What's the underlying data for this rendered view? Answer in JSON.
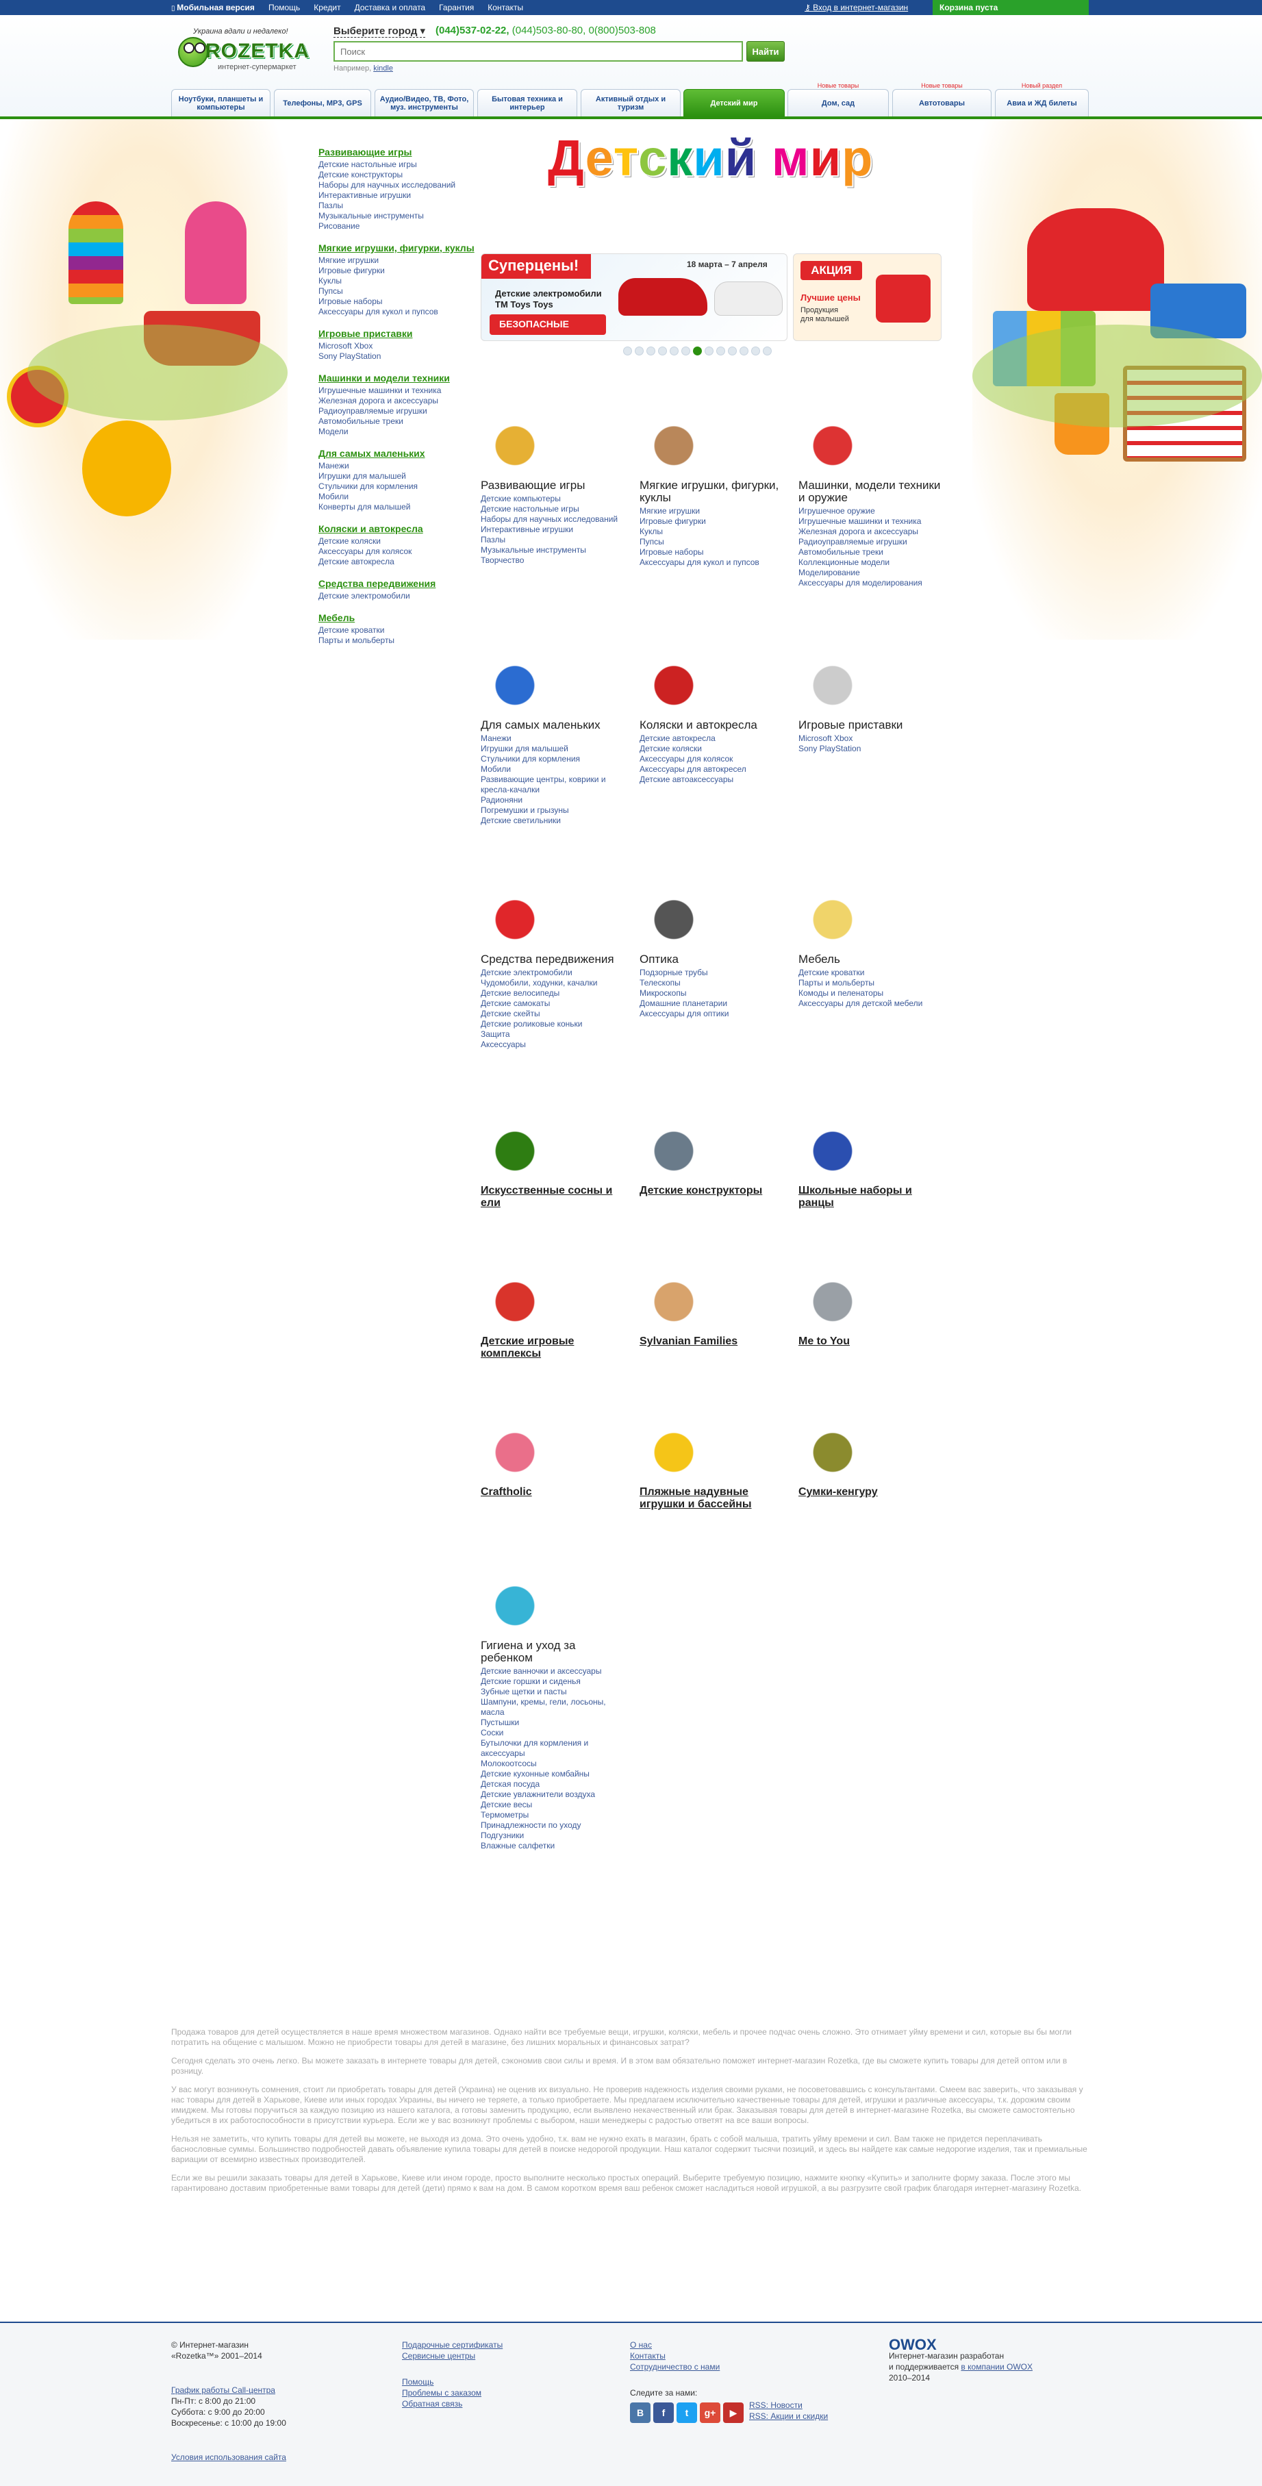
{
  "topbar": {
    "mobile": "Мобильная версия",
    "links": [
      "Помощь",
      "Кредит",
      "Доставка и оплата",
      "Гарантия",
      "Контакты"
    ],
    "login": "Вход в интернет-магазин",
    "cart": "Корзина пуста"
  },
  "header": {
    "slogan": "Украина вдали и недалеко!",
    "logo": "ROZETKA",
    "logo_sub": "интернет-супермаркет",
    "city": "Выберите город ▾",
    "phone_main": "(044)537-02-22,",
    "phones_other": "(044)503-80-80, 0(800)503-808",
    "search_placeholder": "Поиск",
    "search_button": "Найти",
    "example_label": "Например,",
    "example_value": "kindle"
  },
  "tabs": [
    {
      "label": "Ноутбуки, планшеты и компьютеры",
      "badge": ""
    },
    {
      "label": "Телефоны, MP3, GPS",
      "badge": ""
    },
    {
      "label": "Аудио/Видео, ТВ, Фото, муз. инструменты",
      "badge": ""
    },
    {
      "label": "Бытовая техника и интерьер",
      "badge": ""
    },
    {
      "label": "Активный отдых и туризм",
      "badge": ""
    },
    {
      "label": "Детский мир",
      "badge": ""
    },
    {
      "label": "Дом, сад",
      "badge": "Новые товары"
    },
    {
      "label": "Автотовары",
      "badge": "Новые товары"
    },
    {
      "label": "Авиа и ЖД билеты",
      "badge": "Новый раздел"
    }
  ],
  "page_title": "Детский мир",
  "title_colors": [
    "#e31b23",
    "#f7941d",
    "#ffc20e",
    "#8dc63f",
    "#00a651",
    "#00aeef",
    "#2e3192",
    "#92278f",
    "#ec008c",
    "#e31b23",
    "#f7941d"
  ],
  "sidebar": [
    {
      "title": "Развивающие игры",
      "items": [
        "Детские настольные игры",
        "Детские конструкторы",
        "Наборы для научных исследований",
        "Интерактивные игрушки",
        "Пазлы",
        "Музыкальные инструменты",
        "Рисование"
      ]
    },
    {
      "title": "Мягкие игрушки, фигурки, куклы",
      "items": [
        "Мягкие игрушки",
        "Игровые фигурки",
        "Куклы",
        "Пупсы",
        "Игровые наборы",
        "Аксессуары для кукол и пупсов"
      ]
    },
    {
      "title": "Игровые приставки",
      "items": [
        "Microsoft Xbox",
        "Sony PlayStation"
      ]
    },
    {
      "title": "Машинки и модели техники",
      "items": [
        "Игрушечные машинки и техника",
        "Железная дорога и аксессуары",
        "Радиоуправляемые игрушки",
        "Автомобильные треки",
        "Модели"
      ]
    },
    {
      "title": "Для самых маленьких",
      "items": [
        "Манежи",
        "Игрушки для малышей",
        "Стульчики для кормления",
        "Мобили",
        "Конверты для малышей"
      ]
    },
    {
      "title": "Коляски и автокресла",
      "items": [
        "Детские коляски",
        "Аксессуары для колясок",
        "Детские автокресла"
      ]
    },
    {
      "title": "Средства передвижения",
      "items": [
        "Детские электромобили"
      ]
    },
    {
      "title": "Мебель",
      "items": [
        "Детские кроватки",
        "Парты и мольберты"
      ]
    }
  ],
  "promo1": {
    "header": "Суперцены!",
    "date": "18 марта – 7 апреля",
    "desc1": "Детские электромобили",
    "desc2": "TM Toys Toys",
    "free": "БЕЗОПАСНЫЕ"
  },
  "promo2": {
    "header": "АКЦИЯ",
    "price": "Лучшие цены",
    "desc1": "Продукция",
    "desc2": "для малышей"
  },
  "slider_dots": 13,
  "slider_active": 6,
  "categories": [
    {
      "title": "Развивающие игры",
      "items": [
        "Детские компьютеры",
        "Детские настольные игры",
        "Наборы для научных исследований",
        "Интерактивные игрушки",
        "Пазлы",
        "Музыкальные инструменты",
        "Творчество"
      ],
      "icon": "board-game-icon",
      "color": "#e6b034"
    },
    {
      "title": "Мягкие игрушки, фигурки, куклы",
      "items": [
        "Мягкие игрушки",
        "Игровые фигурки",
        "Куклы",
        "Пупсы",
        "Игровые наборы",
        "Аксессуары для кукол и пупсов"
      ],
      "icon": "teddy-bear-icon",
      "color": "#b9875a"
    },
    {
      "title": "Машинки, модели техники и оружие",
      "items": [
        "Игрушечное оружие",
        "Игрушечные машинки и техника",
        "Железная дорога и аксессуары",
        "Радиоуправляемые игрушки",
        "Автомобильные треки",
        "Коллекционные модели",
        "Моделирование",
        "Аксессуары для моделирования"
      ],
      "icon": "toy-train-icon",
      "color": "#d33"
    },
    {
      "title": "Для самых маленьких",
      "items": [
        "Манежи",
        "Игрушки для малышей",
        "Стульчики для кормления",
        "Мобили",
        "Развивающие центры, коврики и кресла-качалки",
        "Радионяни",
        "Погремушки и грызуны",
        "Детские светильники"
      ],
      "icon": "rattle-icon",
      "color": "#2b6cd1"
    },
    {
      "title": "Коляски и автокресла",
      "items": [
        "Детские автокресла",
        "Детские коляски",
        "Аксессуары для колясок",
        "Аксессуары для автокресел",
        "Детские автоаксессуары"
      ],
      "icon": "stroller-icon",
      "color": "#c22"
    },
    {
      "title": "Игровые приставки",
      "items": [
        "Microsoft Xbox",
        "Sony PlayStation"
      ],
      "icon": "console-icon",
      "color": "#ccc"
    },
    {
      "title": "Средства передвижения",
      "items": [
        "Детские электромобили",
        "Чудомобили, ходунки, качалки",
        "Детские велосипеды",
        "Детские самокаты",
        "Детские скейты",
        "Детские роликовые коньки",
        "Защита",
        "Аксессуары"
      ],
      "icon": "quad-bike-icon",
      "color": "#e0262a"
    },
    {
      "title": "Оптика",
      "items": [
        "Подзорные трубы",
        "Телескопы",
        "Микроскопы",
        "Домашние планетарии",
        "Аксессуары для оптики"
      ],
      "icon": "telescope-icon",
      "color": "#555"
    },
    {
      "title": "Мебель",
      "items": [
        "Детские кроватки",
        "Парты и мольберты",
        "Комоды и пеленаторы",
        "Аксессуары для детской мебели"
      ],
      "icon": "wardrobe-icon",
      "color": "#f0d46a"
    },
    {
      "title": "Искусственные сосны и ели",
      "items": [],
      "icon": "christmas-tree-icon",
      "color": "#2e7d12",
      "underline": true
    },
    {
      "title": "Детские конструкторы",
      "items": [],
      "icon": "lego-figure-icon",
      "color": "#6a7b8a",
      "underline": true
    },
    {
      "title": "Школьные наборы и ранцы",
      "items": [],
      "icon": "school-bag-icon",
      "color": "#2b4fb0",
      "underline": true
    },
    {
      "title": "Детские игровые комплексы",
      "items": [],
      "icon": "playground-icon",
      "color": "#d9342b",
      "underline": true
    },
    {
      "title": "Sylvanian Families",
      "items": [],
      "icon": "figurines-icon",
      "color": "#d8a36c",
      "underline": true
    },
    {
      "title": "Me to You",
      "items": [],
      "icon": "grey-bear-icon",
      "color": "#9aa0a6",
      "underline": true
    },
    {
      "title": "Craftholic",
      "items": [],
      "icon": "plush-sloth-icon",
      "color": "#ea6f8a",
      "underline": true
    },
    {
      "title": "Пляжные надувные игрушки и бассейны",
      "items": [],
      "icon": "inflatable-giraffe-icon",
      "color": "#f5c518",
      "underline": true
    },
    {
      "title": "Сумки-кенгуру",
      "items": [],
      "icon": "baby-carrier-icon",
      "color": "#8b8b2e",
      "underline": true
    },
    {
      "title": "Гигиена и уход за ребенком",
      "items": [
        "Детские ванночки и аксессуары",
        "Детские горшки и сиденья",
        "Зубные щетки и пасты",
        "Шампуни, кремы, гели, лосьоны, масла",
        "Пустышки",
        "Соски",
        "Бутылочки для кормления и аксессуары",
        "Молокоотсосы",
        "Детские кухонные комбайны",
        "Детская посуда",
        "Детские увлажнители воздуха",
        "Детские весы",
        "Термометры",
        "Принадлежности по уходу",
        "Подгузники",
        "Влажные салфетки"
      ],
      "icon": "baby-bath-icon",
      "color": "#37b4d6"
    }
  ],
  "seo": [
    "Продажа товаров для детей осуществляется в наше время множеством магазинов. Однако найти все требуемые вещи, игрушки, коляски, мебель и прочее подчас очень сложно. Это отнимает уйму времени и сил, которые вы бы могли потратить на общение с малышом. Можно не приобрести товары для детей в магазине, без лишних моральных и финансовых затрат?",
    "Сегодня сделать это очень легко. Вы можете заказать в интернете товары для детей, сэкономив свои силы и время. И в этом вам обязательно поможет интернет-магазин Rozetka, где вы сможете купить товары для детей оптом или в розницу.",
    "У вас могут возникнуть сомнения, стоит ли приобретать товары для детей (Украина) не оценив их визуально. Не проверив надежность изделия своими руками, не посоветовавшись с консультантами. Смеем вас заверить, что заказывая у нас товары для детей в Харькове, Киеве или иных городах Украины, вы ничего не теряете, а только приобретаете. Мы предлагаем исключительно качественные товары для детей, игрушки и различные аксессуары, т.к. дорожим своим имиджем. Мы готовы поручиться за каждую позицию из нашего каталога, а готовы заменить продукцию, если выявлено некачественный или брак. Заказывая товары для детей в интернет-магазине Rozetka, вы сможете самостоятельно убедиться в их работоспособности в присутствии курьера. Если же у вас возникнут проблемы с выбором, наши менеджеры с радостью ответят на все ваши вопросы.",
    "Нельзя не заметить, что купить товары для детей вы можете, не выходя из дома. Это очень удобно, т.к. вам не нужно ехать в магазин, брать с собой малыша, тратить уйму времени и сил. Вам также не придется переплачивать баснословные суммы. Большинство подробностей давать объявление купила товары для детей в поиске недорогой продукции. Наш каталог содержит тысячи позиций, и здесь вы найдете как самые недорогие изделия, так и премиальные вариации от всемирно известных производителей.",
    "Если же вы решили заказать товары для детей в Харькове, Киеве или ином городе, просто выполните несколько простых операций. Выберите требуемую позицию, нажмите кнопку «Купить» и заполните форму заказа. После этого мы гарантировано доставим приобретенные вами товары для детей (дети) прямо к вам на дом. В самом коротком время ваш ребенок сможет насладиться новой игрушкой, а вы разгрузите свой график благодаря интернет-магазину Rozetka."
  ],
  "footer": {
    "copyright": "© Интернет-магазин «Rozetka™» 2001–2014",
    "schedule_link": "График работы Call-центра",
    "schedule": [
      "Пн-Пт: с 8:00 до 21:00",
      "Суббота: с 9:00 до 20:00",
      "Воскресенье: с 10:00 до 19:00"
    ],
    "terms": "Условия использования сайта",
    "col2a": [
      "Подарочные сертификаты",
      "Сервисные центры"
    ],
    "col2b": [
      "Помощь",
      "Проблемы с заказом",
      "Обратная связь"
    ],
    "col3": [
      "О нас",
      "Контакты",
      "Сотрудничество с нами"
    ],
    "follow": "Следите за нами:",
    "rss": [
      "RSS: Новости",
      "RSS: Акции и скидки"
    ],
    "owox": "OWOX",
    "owox_text1": "Интернет-магазин разработан",
    "owox_text2": "и поддерживается",
    "owox_link": "в компании OWOX",
    "owox_years": "2010–2014"
  }
}
